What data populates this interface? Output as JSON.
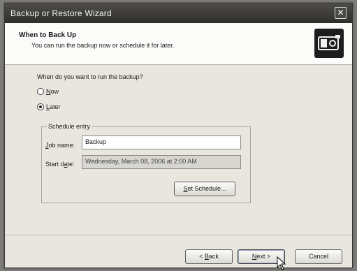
{
  "window": {
    "title": "Backup or Restore Wizard"
  },
  "header": {
    "title": "When to Back Up",
    "subtitle": "You can run the backup now or schedule it for later.",
    "icon": "backup-wizard-icon"
  },
  "question": "When do you want to run the backup?",
  "options": [
    {
      "label_first": "N",
      "label_rest": "ow",
      "checked": false
    },
    {
      "label_first": "L",
      "label_rest": "ater",
      "checked": true
    }
  ],
  "schedule": {
    "group_label": "Schedule entry",
    "job_label_first": "J",
    "job_label_rest": "ob name:",
    "job_value": "Backup",
    "start_label_first": "Start d",
    "start_label_u": "a",
    "start_label_rest": "te:",
    "start_value": "Wednesday, March 08, 2006 at 2:00 AM",
    "set_schedule_first": "S",
    "set_schedule_rest": "et Schedule..."
  },
  "buttons": {
    "back_prefix": "< ",
    "back_u": "B",
    "back_rest": "ack",
    "next_u": "N",
    "next_rest": "ext >",
    "cancel": "Cancel"
  },
  "colors": {
    "titlebar": "#2f2e2c",
    "window": "#e8e6df",
    "header": "#fbfbf9"
  }
}
